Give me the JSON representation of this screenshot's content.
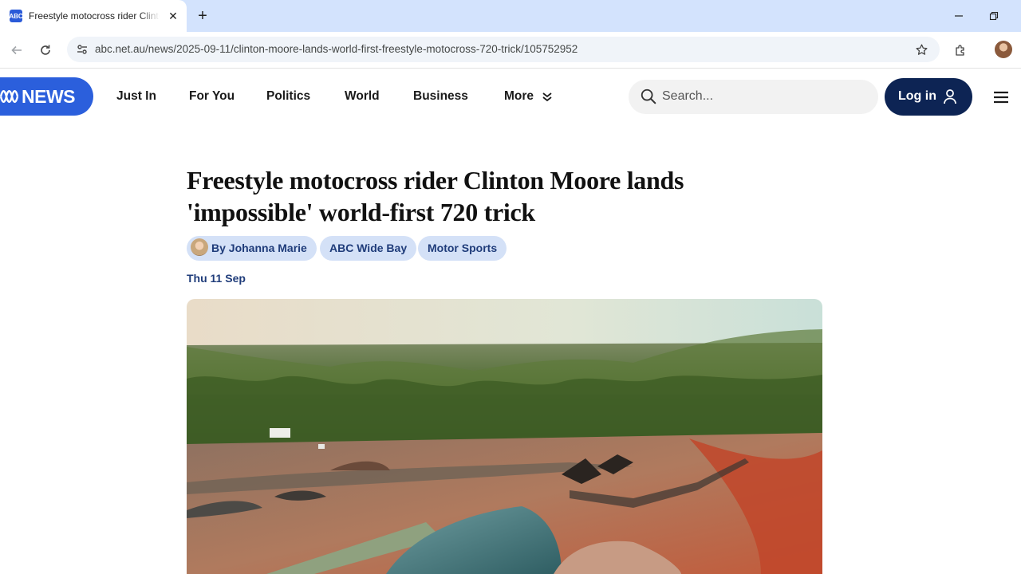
{
  "browser": {
    "tab": {
      "favicon": "ABC",
      "title": "Freestyle motocross rider Clinton Moore lands 'impossible' world-first 720 trick",
      "close": "✕"
    },
    "new_tab": "+",
    "url": "abc.net.au/news/2025-09-11/clinton-moore-lands-world-first-freestyle-motocross-720-trick/105752952",
    "icons": [
      "back-arrow-icon",
      "reload-icon",
      "site-info-icon",
      "star-icon",
      "extensions-icon",
      "profile-avatar",
      "minimize-icon",
      "restore-icon"
    ]
  },
  "site": {
    "logo": "NEWS",
    "nav": [
      "Just In",
      "For You",
      "Politics",
      "World",
      "Business",
      "More"
    ],
    "search_placeholder": "Search...",
    "login": "Log in",
    "brand_color": "#2b5fdc",
    "login_color": "#0d2454"
  },
  "article": {
    "headline": "Freestyle motocross rider Clinton Moore lands 'impossible' world-first 720 trick",
    "author": "By Johanna Marie",
    "tags": [
      "ABC Wide Bay",
      "Motor Sports"
    ],
    "date": "Thu 11 Sep"
  }
}
